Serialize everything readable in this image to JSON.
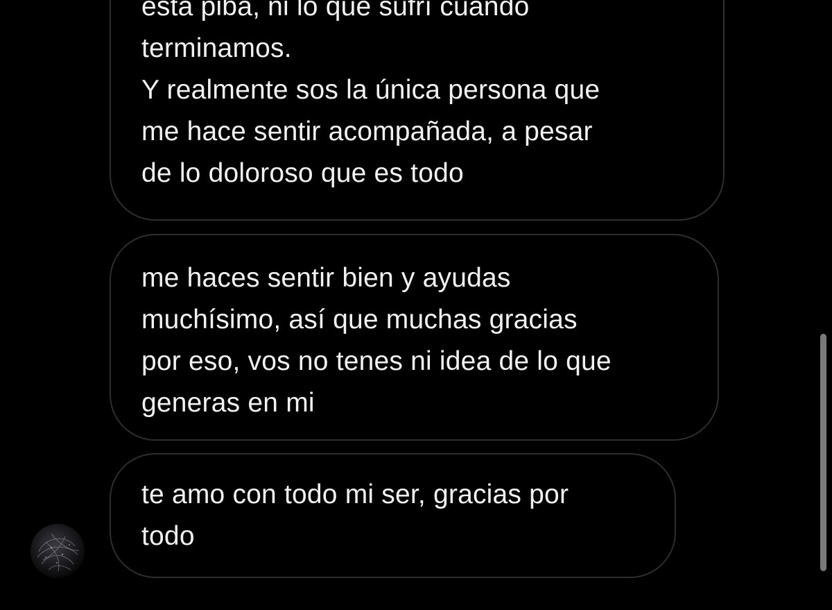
{
  "messages": [
    {
      "id": "msg-1",
      "paragraphs": [
        [
          "esta piba, ni lo que sufrí cuando",
          "terminamos."
        ],
        [
          "Y realmente sos la única persona que",
          "me hace sentir acompañada, a pesar",
          "de lo doloroso que es todo"
        ]
      ]
    },
    {
      "id": "msg-2",
      "paragraphs": [
        [
          "me haces sentir bien y ayudas",
          "muchísimo, así que muchas gracias",
          "por eso, vos no tenes ni idea de lo que",
          "generas en mi"
        ]
      ]
    },
    {
      "id": "msg-3",
      "paragraphs": [
        [
          "te amo con todo mi ser, gracias por",
          "todo"
        ]
      ]
    }
  ],
  "colors": {
    "background": "#000000",
    "bubble_border": "#2e2e2e",
    "text": "#f2f2f2",
    "scrollbar": "#7a7a7a"
  },
  "icons": {
    "avatar": "sender-avatar"
  }
}
